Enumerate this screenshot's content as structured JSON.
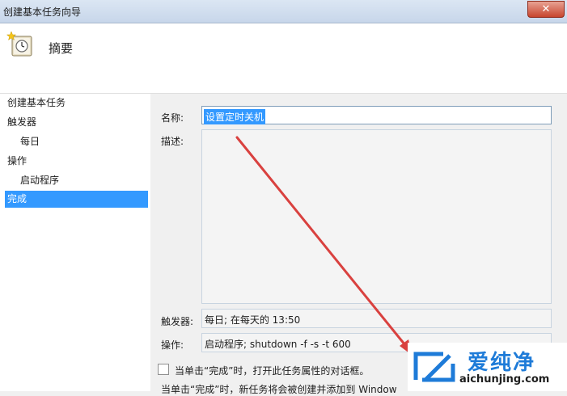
{
  "window": {
    "title": "创建基本任务向导",
    "close_glyph": "✕"
  },
  "header": {
    "title": "摘要"
  },
  "steps": [
    {
      "label": "创建基本任务",
      "level": 0,
      "selected": false
    },
    {
      "label": "触发器",
      "level": 0,
      "selected": false
    },
    {
      "label": "每日",
      "level": 1,
      "selected": false
    },
    {
      "label": "操作",
      "level": 0,
      "selected": false
    },
    {
      "label": "启动程序",
      "level": 1,
      "selected": false
    },
    {
      "label": "完成",
      "level": 0,
      "selected": true
    }
  ],
  "form": {
    "name_label": "名称:",
    "name_value": "设置定时关机",
    "description_label": "描述:",
    "description_value": "",
    "trigger_label": "触发器:",
    "trigger_value": "每日; 在每天的 13:50",
    "action_label": "操作:",
    "action_value": "启动程序; shutdown -f -s -t 600",
    "open_properties_label": "当单击“完成”时，打开此任务属性的对话框。",
    "open_properties_checked": false,
    "finish_note": "当单击“完成”时，新任务将会被创建并添加到 Window"
  },
  "watermark": {
    "brand": "爱纯净",
    "url": "aichunjing.com"
  },
  "colors": {
    "selection": "#3399ff",
    "arrow": "#d9413f",
    "brand": "#1e7bd8"
  }
}
